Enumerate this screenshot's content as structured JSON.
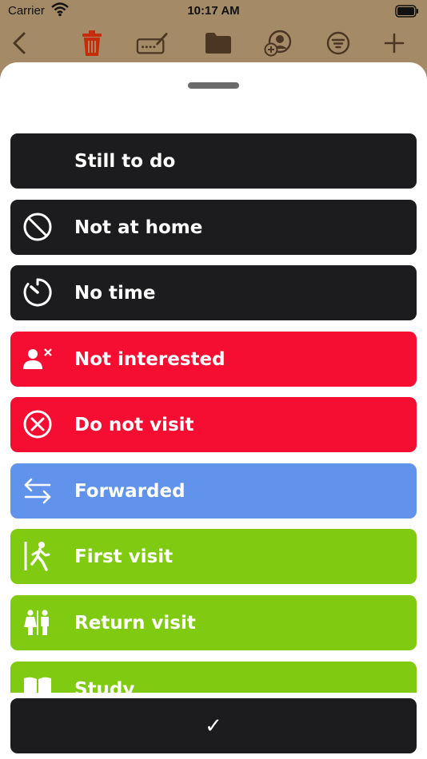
{
  "status_bar": {
    "carrier": "Carrier",
    "time": "10:17 AM"
  },
  "toolbar": {
    "icons": [
      "back-chevron-icon",
      "trash-icon",
      "keyboard-edit-icon",
      "folder-icon",
      "add-person-icon",
      "filter-icon",
      "plus-icon"
    ],
    "accent_color": "#c62b0a",
    "icon_color": "#4a3622"
  },
  "sheet": {
    "items": [
      {
        "label": "Still to do",
        "icon": "none",
        "color": "#1c1c1e"
      },
      {
        "label": "Not at home",
        "icon": "prohibited-icon",
        "color": "#1c1c1e"
      },
      {
        "label": "No time",
        "icon": "timer-icon",
        "color": "#1c1c1e"
      },
      {
        "label": "Not interested",
        "icon": "person-x-icon",
        "color": "#f50e32"
      },
      {
        "label": "Do not visit",
        "icon": "circle-x-icon",
        "color": "#f50e32"
      },
      {
        "label": "Forwarded",
        "icon": "arrows-exchange-icon",
        "color": "#6293ec"
      },
      {
        "label": "First visit",
        "icon": "walking-person-icon",
        "color": "#80cb12"
      },
      {
        "label": "Return visit",
        "icon": "two-people-icon",
        "color": "#80cb12"
      },
      {
        "label": "Study",
        "icon": "book-icon",
        "color": "#80cb12"
      }
    ],
    "confirm_label": "✓"
  }
}
